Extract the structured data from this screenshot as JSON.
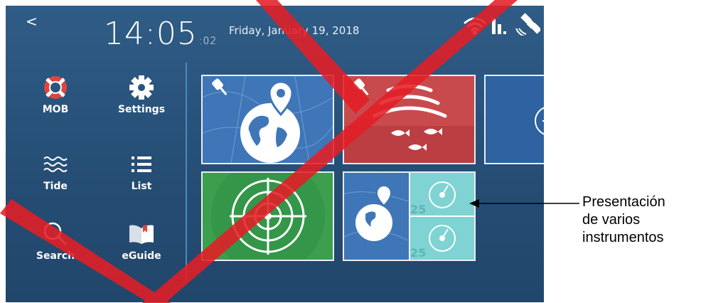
{
  "status_bar": {
    "back_glyph": "<",
    "time_hm": "14:05",
    "time_seconds": ":02",
    "date": "Friday, January 19, 2018",
    "icons": [
      "wifi-icon",
      "signal-bars-icon",
      "satellite-icon"
    ]
  },
  "sidebar": {
    "items": [
      {
        "label": "MOB",
        "icon": "lifebuoy-icon"
      },
      {
        "label": "Settings",
        "icon": "gear-icon"
      },
      {
        "label": "Tide",
        "icon": "waves-icon"
      },
      {
        "label": "List",
        "icon": "list-icon"
      },
      {
        "label": "Search",
        "icon": "magnifier-icon"
      },
      {
        "label": "eGuide",
        "icon": "book-icon"
      }
    ]
  },
  "tiles": [
    {
      "name": "chart",
      "color": "#3f76b8",
      "pinned": true
    },
    {
      "name": "fishfinder",
      "color": "#c94a4d",
      "pinned": true
    },
    {
      "name": "add-new",
      "color": "#2e62a0",
      "pinned": false
    },
    {
      "name": "radar",
      "color": "#3b9f4e",
      "pinned": false
    },
    {
      "name": "multi-instrument",
      "color": "#3f76b8",
      "pinned": false,
      "gauge_value": "25"
    }
  ],
  "callout": {
    "lines": [
      "Presentación",
      "de varios",
      "instrumentos"
    ]
  },
  "colors": {
    "background": "#2a5580",
    "divider": "#4f88bd",
    "watermark": "#e41e26",
    "gauge": "#7fd3d2"
  }
}
